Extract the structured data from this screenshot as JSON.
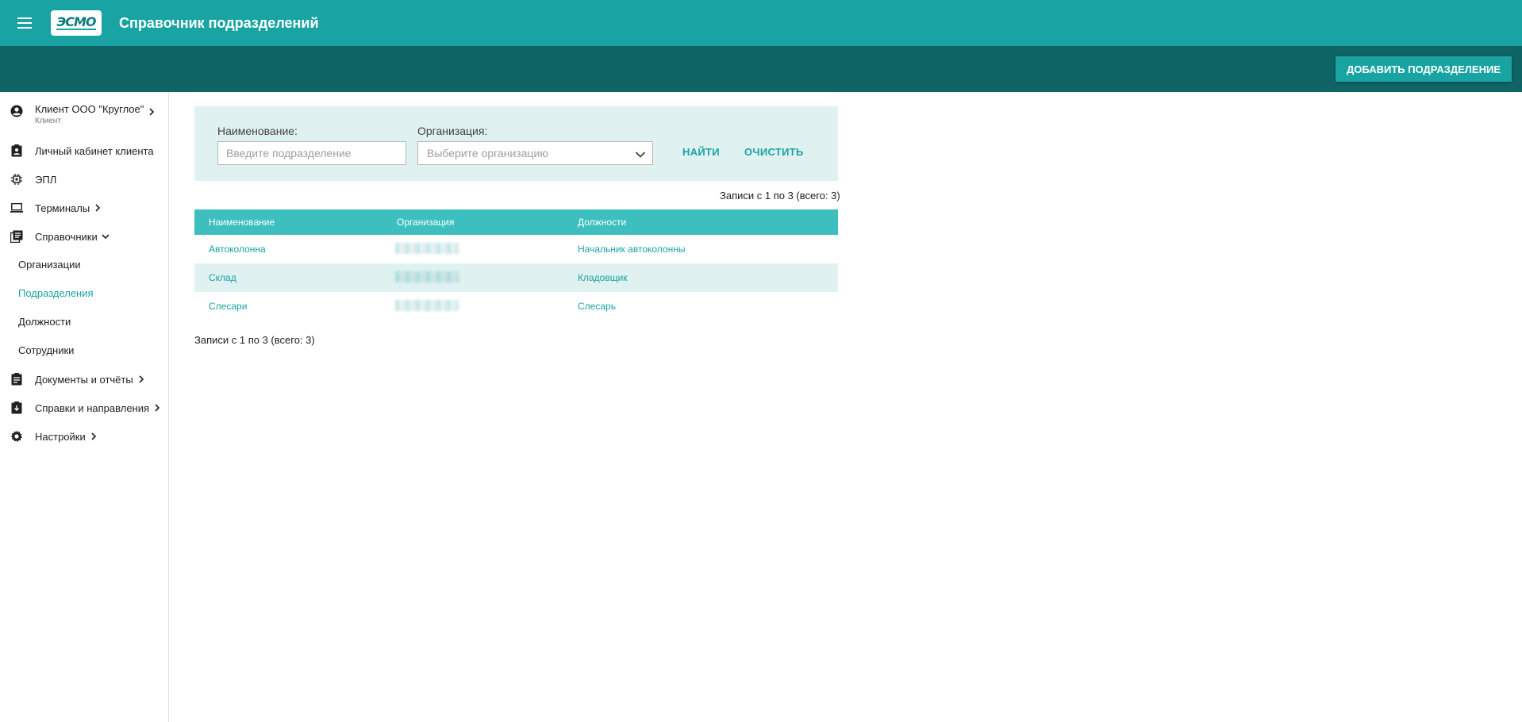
{
  "header": {
    "logo_text": "ЭСМО",
    "title": "Справочник подразделений"
  },
  "subbar": {
    "add_button": "ДОБАВИТЬ ПОДРАЗДЕЛЕНИЕ"
  },
  "sidebar": {
    "user": {
      "name": "Клиент ООО \"Круглое\"",
      "role": "Клиент"
    },
    "items": [
      {
        "label": "Личный кабинет клиента",
        "icon": "client-card-icon"
      },
      {
        "label": "ЭПЛ",
        "icon": "chip-icon"
      },
      {
        "label": "Терминалы",
        "icon": "laptop-icon"
      },
      {
        "label": "Справочники",
        "icon": "library-books-icon"
      },
      {
        "label": "Документы и отчёты",
        "icon": "clipboard-icon"
      },
      {
        "label": "Справки и направления",
        "icon": "clipboard-download-icon"
      },
      {
        "label": "Настройки",
        "icon": "gear-icon"
      }
    ],
    "sub_items": [
      {
        "label": "Организации"
      },
      {
        "label": "Подразделения"
      },
      {
        "label": "Должности"
      },
      {
        "label": "Сотрудники"
      }
    ]
  },
  "filter": {
    "name_label": "Наименование:",
    "name_placeholder": "Введите подразделение",
    "org_label": "Организация:",
    "org_placeholder": "Выберите организацию",
    "find_button": "НАЙТИ",
    "clear_button": "ОЧИСТИТЬ"
  },
  "records_info": "Записи с 1 по 3 (всего: 3)",
  "table": {
    "columns": [
      "Наименование",
      "Организация",
      "Должности"
    ],
    "rows": [
      {
        "name": "Автоколонна",
        "position": "Начальник автоколонны"
      },
      {
        "name": "Склад",
        "position": "Кладовщик"
      },
      {
        "name": "Слесари",
        "position": "Слесарь"
      }
    ]
  },
  "colors": {
    "header": "#1aa3a3",
    "subbar": "#0f6466",
    "table_header": "#3dbfbf",
    "accent": "#1aa3a3",
    "row_alt": "#dff1f0"
  }
}
